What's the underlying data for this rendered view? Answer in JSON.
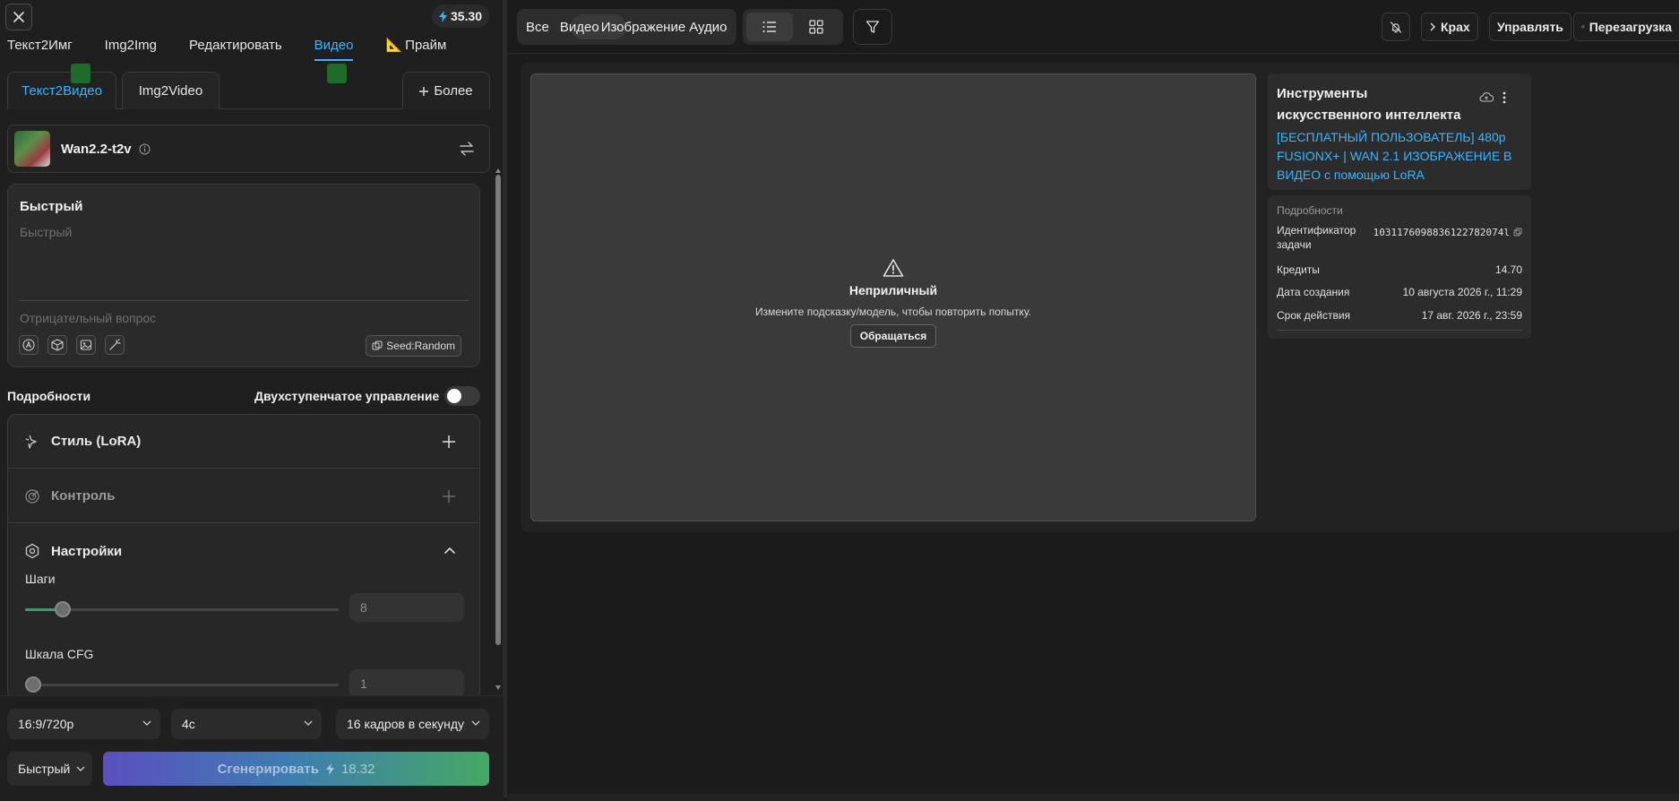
{
  "header": {
    "credits": "35.30"
  },
  "top_tabs": [
    {
      "label": "Текст2Имг"
    },
    {
      "label": "Img2Img"
    },
    {
      "label": "Редактировать"
    },
    {
      "label": "Видео"
    },
    {
      "label": "Прайм"
    }
  ],
  "sub_tabs": {
    "text2video": "Текст2Видео",
    "img2video": "Img2Video",
    "more": "Более"
  },
  "model": {
    "name": "Wan2.2-t2v"
  },
  "prompt": {
    "title": "Быстрый",
    "placeholder": "Быстрый",
    "negative_placeholder": "Отрицательный вопрос",
    "seed_label": "Seed:Random"
  },
  "details": {
    "label": "Подробности",
    "two_step_label": "Двухступенчатое управление",
    "two_step_on": false
  },
  "accordion": {
    "style_label": "Стиль (LoRA)",
    "control_label": "Контроль",
    "settings_label": "Настройки"
  },
  "settings": {
    "steps_label": "Шаги",
    "steps_value": "8",
    "steps_fraction": 0.12,
    "cfg_label": "Шкала CFG",
    "cfg_value": "1",
    "cfg_fraction": 0.0
  },
  "bottom": {
    "aspect": "16:9/720p",
    "duration": "4с",
    "fps": "16 кадров в секунду",
    "mode": "Быстрый",
    "generate_label": "Сгенерировать",
    "generate_cost": "18.32"
  },
  "toolbar": {
    "filter_all": "Все",
    "filter_video": "Видео",
    "filter_image": "Изображение",
    "filter_audio": "Аудио",
    "crash_label": "Крах",
    "manage_label": "Управлять",
    "reload_label": "Перезагрузка"
  },
  "preview": {
    "error_title": "Неприличный",
    "error_subtitle": "Измените подсказку/модель, чтобы повторить попытку.",
    "contact_label": "Обращаться"
  },
  "info_card": {
    "title": "Инструменты искусственного интеллекта",
    "link_text": "[БЕСПЛАТНЫЙ ПОЛЬЗОВАТЕЛЬ] 480p FUSIONX+ | WAN 2.1 ИЗОБРАЖЕНИЕ В ВИДЕО с помощью LoRA"
  },
  "details_card": {
    "title": "Подробности",
    "task_id_label": "Идентификатор задачи",
    "task_id_value": "1031176098836122782074l",
    "credits_label": "Кредиты",
    "credits_value": "14.70",
    "created_label": "Дата создания",
    "created_value": "10 августа 2026 г., 11:29",
    "expires_label": "Срок действия",
    "expires_value": "17 авг. 2026 г., 23:59"
  },
  "colors": {
    "accent": "#38b6ff",
    "slider_fill": "#2fa36b",
    "generate_start": "#5b4fbf",
    "generate_end": "#45a865"
  }
}
